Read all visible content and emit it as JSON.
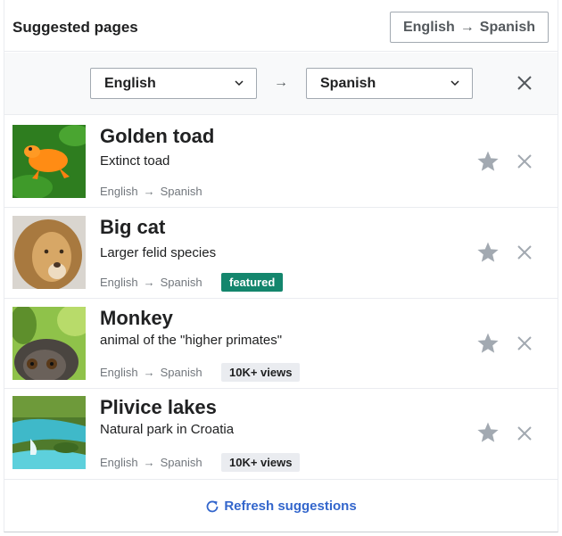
{
  "header": {
    "title": "Suggested pages",
    "language_toggle": {
      "source": "English",
      "arrow": "→",
      "target": "Spanish"
    }
  },
  "filter": {
    "source_language": "English",
    "target_language": "Spanish",
    "arrow": "→"
  },
  "suggestions": [
    {
      "title": "Golden toad",
      "description": "Extinct toad",
      "source": "English",
      "arrow": "→",
      "target": "Spanish",
      "badge": ""
    },
    {
      "title": "Big cat",
      "description": "Larger felid species",
      "source": "English",
      "arrow": "→",
      "target": "Spanish",
      "badge": "featured"
    },
    {
      "title": "Monkey",
      "description": "animal of the \"higher primates\"",
      "source": "English",
      "arrow": "→",
      "target": "Spanish",
      "badge": "10K+ views"
    },
    {
      "title": "Plivice lakes",
      "description": "Natural park in Croatia",
      "source": "English",
      "arrow": "→",
      "target": "Spanish",
      "badge": "10K+ views"
    }
  ],
  "footer": {
    "refresh_label": "Refresh suggestions"
  },
  "colors": {
    "link": "#3366cc",
    "featured": "#14866d",
    "icon_gray": "#a2a9b1"
  }
}
